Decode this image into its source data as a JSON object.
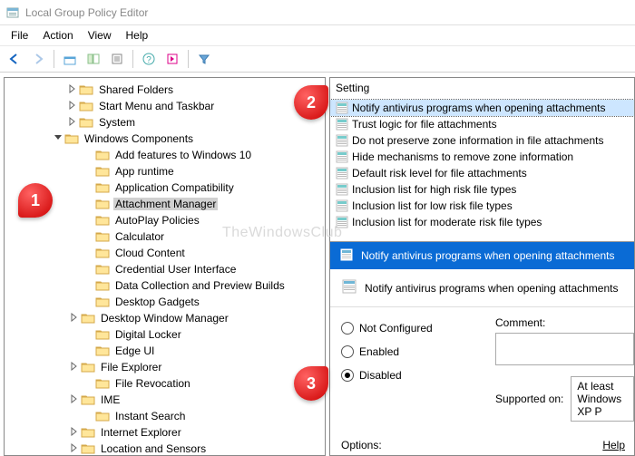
{
  "window": {
    "title": "Local Group Policy Editor"
  },
  "menu": {
    "file": "File",
    "action": "Action",
    "view": "View",
    "help": "Help"
  },
  "tree": {
    "indent_base": 50,
    "items": [
      {
        "label": "Shared Folders",
        "indent": 68,
        "exp": ">"
      },
      {
        "label": "Start Menu and Taskbar",
        "indent": 68,
        "exp": ">"
      },
      {
        "label": "System",
        "indent": 68,
        "exp": ">"
      },
      {
        "label": "Windows Components",
        "indent": 52,
        "exp": "v",
        "expanded": true
      },
      {
        "label": "Add features to Windows 10",
        "indent": 86,
        "exp": ""
      },
      {
        "label": "App runtime",
        "indent": 86,
        "exp": ""
      },
      {
        "label": "Application Compatibility",
        "indent": 86,
        "exp": ""
      },
      {
        "label": "Attachment Manager",
        "indent": 86,
        "exp": "",
        "selected": true
      },
      {
        "label": "AutoPlay Policies",
        "indent": 86,
        "exp": ""
      },
      {
        "label": "Calculator",
        "indent": 86,
        "exp": ""
      },
      {
        "label": "Cloud Content",
        "indent": 86,
        "exp": ""
      },
      {
        "label": "Credential User Interface",
        "indent": 86,
        "exp": ""
      },
      {
        "label": "Data Collection and Preview Builds",
        "indent": 86,
        "exp": ""
      },
      {
        "label": "Desktop Gadgets",
        "indent": 86,
        "exp": ""
      },
      {
        "label": "Desktop Window Manager",
        "indent": 70,
        "exp": ">"
      },
      {
        "label": "Digital Locker",
        "indent": 86,
        "exp": ""
      },
      {
        "label": "Edge UI",
        "indent": 86,
        "exp": ""
      },
      {
        "label": "File Explorer",
        "indent": 70,
        "exp": ">"
      },
      {
        "label": "File Revocation",
        "indent": 86,
        "exp": ""
      },
      {
        "label": "IME",
        "indent": 70,
        "exp": ">"
      },
      {
        "label": "Instant Search",
        "indent": 86,
        "exp": ""
      },
      {
        "label": "Internet Explorer",
        "indent": 70,
        "exp": ">"
      },
      {
        "label": "Location and Sensors",
        "indent": 70,
        "exp": ">"
      }
    ]
  },
  "settings": {
    "header": "Setting",
    "items": [
      {
        "label": "Notify antivirus programs when opening attachments",
        "selected": true
      },
      {
        "label": "Trust logic for file attachments"
      },
      {
        "label": "Do not preserve zone information in file attachments"
      },
      {
        "label": "Hide mechanisms to remove zone information"
      },
      {
        "label": "Default risk level for file attachments"
      },
      {
        "label": "Inclusion list for high risk file types"
      },
      {
        "label": "Inclusion list for low risk file types"
      },
      {
        "label": "Inclusion list for moderate risk file types"
      }
    ]
  },
  "dialog": {
    "title": "Notify antivirus programs when opening attachments",
    "heading": "Notify antivirus programs when opening attachments",
    "radios": {
      "not_configured": "Not Configured",
      "enabled": "Enabled",
      "disabled": "Disabled",
      "selected": "disabled"
    },
    "comment_label": "Comment:",
    "supported_label": "Supported on:",
    "supported_value": "At least Windows XP P",
    "options_label": "Options:",
    "help_label": "Help"
  },
  "callouts": {
    "c1": "1",
    "c2": "2",
    "c3": "3"
  },
  "watermark": "TheWindowsClub"
}
